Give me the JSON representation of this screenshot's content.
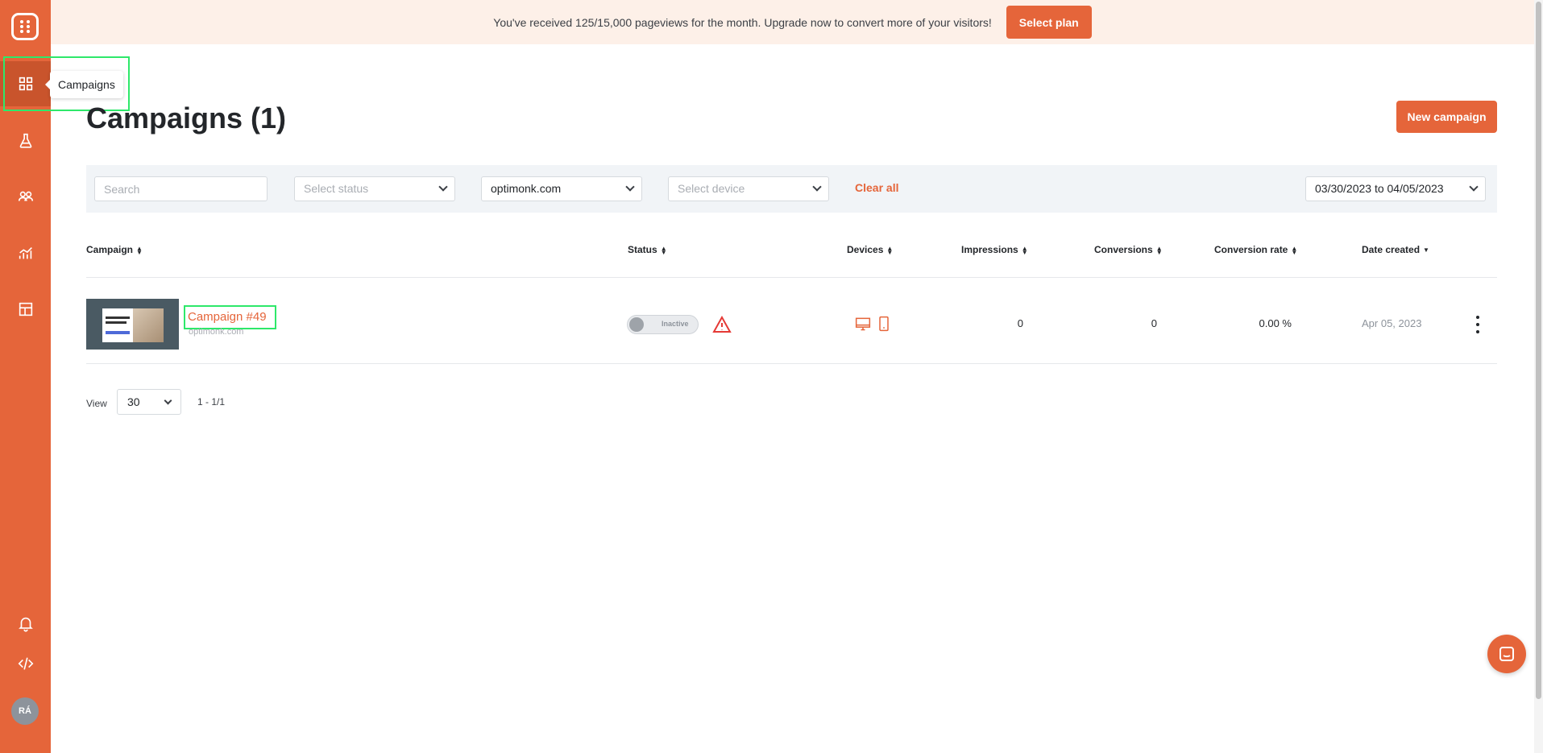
{
  "banner": {
    "message": "You've received 125/15,000 pageviews for the month. Upgrade now to convert more of your visitors!",
    "button": "Select plan"
  },
  "sidebar": {
    "items": [
      {
        "icon": "grid-icon",
        "label": "Campaigns",
        "active": true
      },
      {
        "icon": "flask-icon"
      },
      {
        "icon": "users-icon"
      },
      {
        "icon": "analytics-icon"
      },
      {
        "icon": "layout-icon"
      }
    ],
    "tooltip": "Campaigns",
    "avatar": "RÁ"
  },
  "header": {
    "title": "Campaigns (1)",
    "new_campaign": "New campaign"
  },
  "filters": {
    "search_placeholder": "Search",
    "status_placeholder": "Select status",
    "domain": "optimonk.com",
    "device_placeholder": "Select device",
    "clear_all": "Clear all",
    "date_range": "03/30/2023 to 04/05/2023"
  },
  "table": {
    "headers": {
      "campaign": "Campaign",
      "status": "Status",
      "devices": "Devices",
      "impressions": "Impressions",
      "conversions": "Conversions",
      "conversion_rate": "Conversion rate",
      "date_created": "Date created"
    },
    "rows": [
      {
        "name": "Campaign #49",
        "domain": "optimonk.com",
        "status": "Inactive",
        "impressions": "0",
        "conversions": "0",
        "conversion_rate": "0.00 %",
        "date_created": "Apr 05, 2023"
      }
    ]
  },
  "pagination": {
    "view_label": "View",
    "per_page": "30",
    "range": "1 - 1/1"
  },
  "colors": {
    "accent": "#e5653a",
    "highlight": "#2ee86a"
  }
}
